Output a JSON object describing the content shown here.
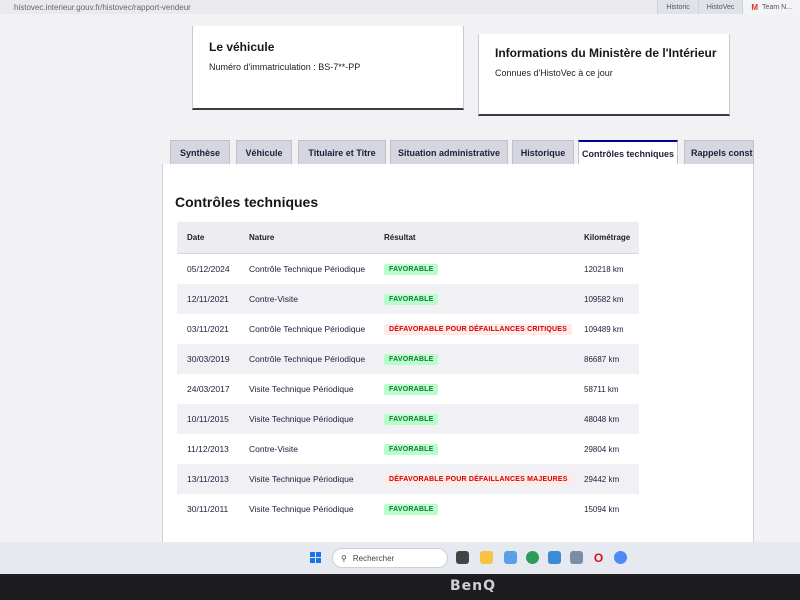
{
  "browser": {
    "url": "histovec.interieur.gouv.fr/histovec/rapport-vendeur",
    "tabs": [
      {
        "label": "Historic"
      },
      {
        "label": "HistoVec"
      },
      {
        "label": "Team N..."
      }
    ]
  },
  "vehicle_card": {
    "title": "Le véhicule",
    "plate_label": "Numéro d'immatriculation : BS-7**-PP"
  },
  "ministry_card": {
    "title": "Informations du Ministère de l'Intérieur",
    "text": "Connues d'HistoVec à ce jour"
  },
  "tabs": [
    {
      "label": "Synthèse",
      "active": false
    },
    {
      "label": "Véhicule",
      "active": false
    },
    {
      "label": "Titulaire et Titre",
      "active": false
    },
    {
      "label": "Situation administrative",
      "active": false
    },
    {
      "label": "Historique",
      "active": false
    },
    {
      "label": "Contrôles techniques",
      "active": true
    },
    {
      "label": "Rappels constructeur",
      "active": false
    }
  ],
  "section": {
    "title": "Contrôles techniques",
    "headers": {
      "date": "Date",
      "nature": "Nature",
      "result": "Résultat",
      "km": "Kilométrage"
    },
    "rows": [
      {
        "date": "05/12/2024",
        "nature": "Contrôle Technique Périodique",
        "result": "FAVORABLE",
        "status": "ok",
        "km": "120218 km"
      },
      {
        "date": "12/11/2021",
        "nature": "Contre-Visite",
        "result": "FAVORABLE",
        "status": "ok",
        "km": "109582 km"
      },
      {
        "date": "03/11/2021",
        "nature": "Contrôle Technique Périodique",
        "result": "DÉFAVORABLE POUR DÉFAILLANCES CRITIQUES",
        "status": "ko",
        "km": "109489 km"
      },
      {
        "date": "30/03/2019",
        "nature": "Contrôle Technique Périodique",
        "result": "FAVORABLE",
        "status": "ok",
        "km": "86687 km"
      },
      {
        "date": "24/03/2017",
        "nature": "Visite Technique Périodique",
        "result": "FAVORABLE",
        "status": "ok",
        "km": "58711 km"
      },
      {
        "date": "10/11/2015",
        "nature": "Visite Technique Périodique",
        "result": "FAVORABLE",
        "status": "ok",
        "km": "48048 km"
      },
      {
        "date": "11/12/2013",
        "nature": "Contre-Visite",
        "result": "FAVORABLE",
        "status": "ok",
        "km": "29804 km"
      },
      {
        "date": "13/11/2013",
        "nature": "Visite Technique Périodique",
        "result": "DÉFAVORABLE POUR DÉFAILLANCES MAJEURES",
        "status": "ko",
        "km": "29442 km"
      },
      {
        "date": "30/11/2011",
        "nature": "Visite Technique Périodique",
        "result": "FAVORABLE",
        "status": "ok",
        "km": "15094 km"
      }
    ]
  },
  "taskbar": {
    "search_placeholder": "Rechercher"
  },
  "monitor": {
    "brand": "BenQ"
  },
  "colors": {
    "favorable_bg": "#b8fec9",
    "favorable_text": "#18753c",
    "defavorable_bg": "#ffe9e9",
    "defavorable_text": "#ce0500",
    "accent": "#000091"
  }
}
